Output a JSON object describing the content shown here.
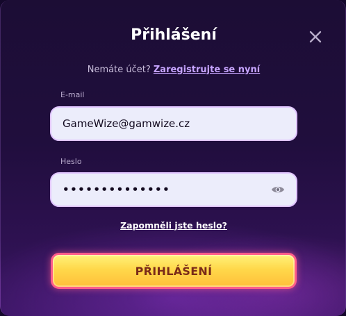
{
  "modal": {
    "title": "Přihlášení",
    "close_icon": "close-icon"
  },
  "register": {
    "prompt": "Nemáte účet?",
    "link": "Zaregistrujte se nyní"
  },
  "email": {
    "label": "E-mail",
    "value": "GameWize@gamwize.cz"
  },
  "password": {
    "label": "Heslo",
    "masked_value": "••••••••••••••",
    "toggle_icon": "eye-icon"
  },
  "forgot_link": "Zapomněli jste heslo?",
  "submit_label": "PŘIHLÁŠENÍ",
  "colors": {
    "background": "#1c0d35",
    "field_bg": "#ecedfb",
    "link": "#c7a5ff",
    "button_fill": "#ffd84a",
    "button_border": "#ff5c8a",
    "button_text": "#7a2a18"
  }
}
